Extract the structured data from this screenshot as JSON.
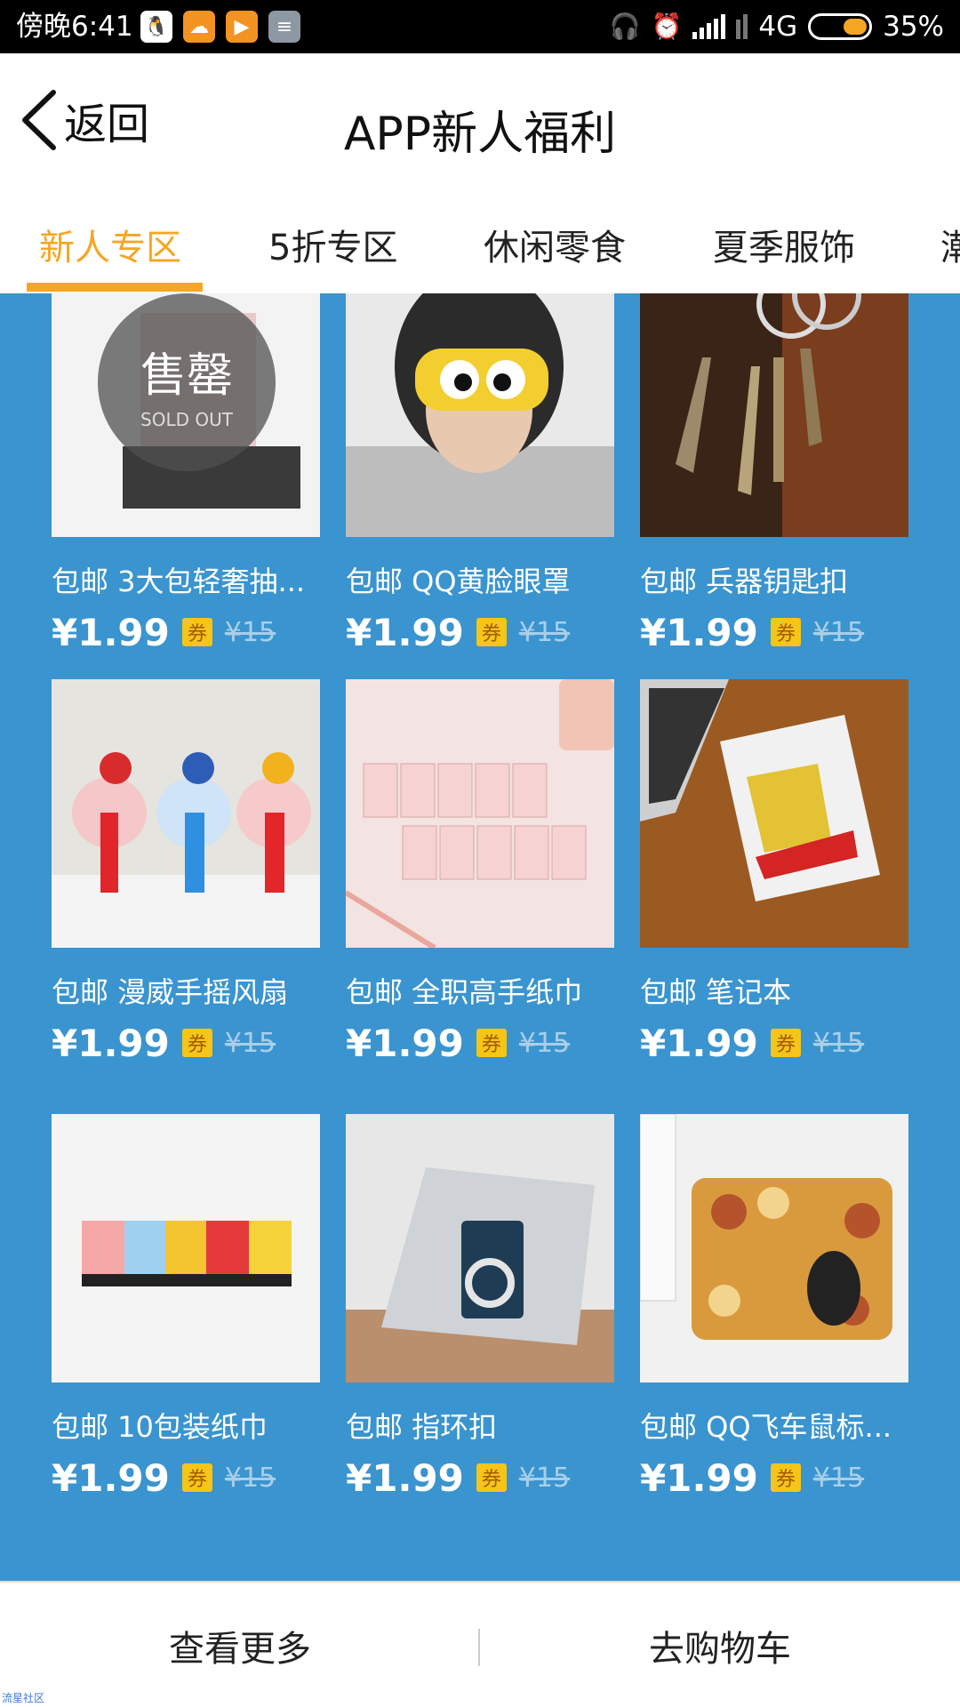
{
  "status_bar": {
    "time": "傍晚6:41",
    "network": "4G",
    "battery": "35%",
    "icons": [
      "qq-icon",
      "weather-icon",
      "video-icon",
      "note-icon",
      "headphone-icon",
      "alarm-icon",
      "signal-icon",
      "battery-icon"
    ]
  },
  "header": {
    "back_label": "返回",
    "title": "APP新人福利"
  },
  "tabs": [
    {
      "label": "新人专区",
      "active": true
    },
    {
      "label": "5折专区",
      "active": false
    },
    {
      "label": "休闲零食",
      "active": false
    },
    {
      "label": "夏季服饰",
      "active": false
    },
    {
      "label": "潮",
      "active": false
    }
  ],
  "colors": {
    "accent": "#f5a623",
    "content_bg": "#3a94cf",
    "coupon_bg": "#f5c518"
  },
  "products": [
    {
      "name": "包邮 3大包轻奢抽...",
      "price": "¥1.99",
      "coupon": "券",
      "original_price": "¥15",
      "sold_out": true,
      "sold_out_text": "售罄",
      "sold_out_en": "SOLD OUT"
    },
    {
      "name": "包邮 QQ黄脸眼罩",
      "price": "¥1.99",
      "coupon": "券",
      "original_price": "¥15"
    },
    {
      "name": "包邮 兵器钥匙扣",
      "price": "¥1.99",
      "coupon": "券",
      "original_price": "¥15"
    },
    {
      "name": "包邮 漫威手摇风扇",
      "price": "¥1.99",
      "coupon": "券",
      "original_price": "¥15"
    },
    {
      "name": "包邮 全职高手纸巾",
      "price": "¥1.99",
      "coupon": "券",
      "original_price": "¥15"
    },
    {
      "name": "包邮 笔记本",
      "price": "¥1.99",
      "coupon": "券",
      "original_price": "¥15"
    },
    {
      "name": "包邮 10包装纸巾",
      "price": "¥1.99",
      "coupon": "券",
      "original_price": "¥15"
    },
    {
      "name": "包邮 指环扣",
      "price": "¥1.99",
      "coupon": "券",
      "original_price": "¥15"
    },
    {
      "name": "包邮 QQ飞车鼠标...",
      "price": "¥1.99",
      "coupon": "券",
      "original_price": "¥15"
    }
  ],
  "bottom_bar": {
    "more_label": "查看更多",
    "cart_label": "去购物车"
  },
  "watermark": "流星社区"
}
